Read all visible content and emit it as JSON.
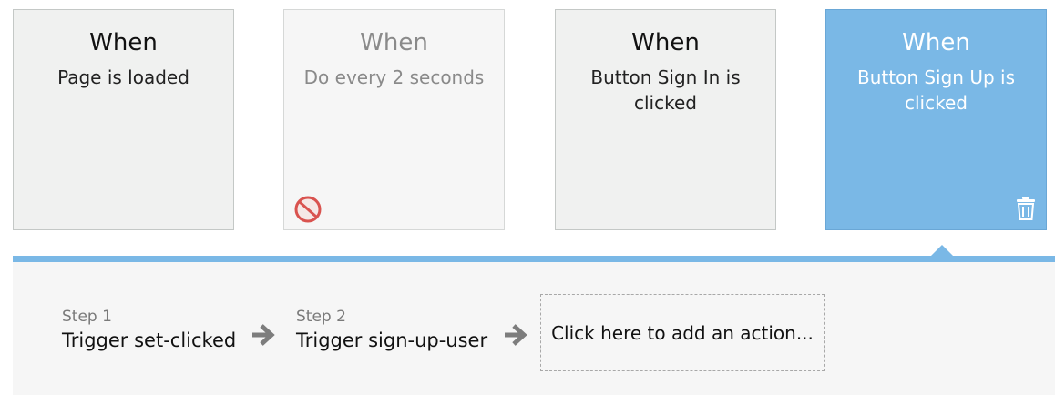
{
  "events": [
    {
      "when": "When",
      "description": "Page is loaded",
      "state": "normal"
    },
    {
      "when": "When",
      "description": "Do every 2 seconds",
      "state": "disabled",
      "icon": "disabled-icon"
    },
    {
      "when": "When",
      "description": "Button Sign In is clicked",
      "state": "normal"
    },
    {
      "when": "When",
      "description": "Button Sign Up is clicked",
      "state": "selected",
      "icon": "trash-icon"
    }
  ],
  "actions": {
    "steps": [
      {
        "step": "Step 1",
        "name": "Trigger set-clicked"
      },
      {
        "step": "Step 2",
        "name": "Trigger sign-up-user"
      }
    ],
    "add_action_label": "Click here to add an action...",
    "arrow_icon": "arrow-right-icon"
  },
  "colors": {
    "selected": "#7ab8e6",
    "card_bg": "#f0f1f0",
    "panel_bg": "#f6f6f6"
  }
}
